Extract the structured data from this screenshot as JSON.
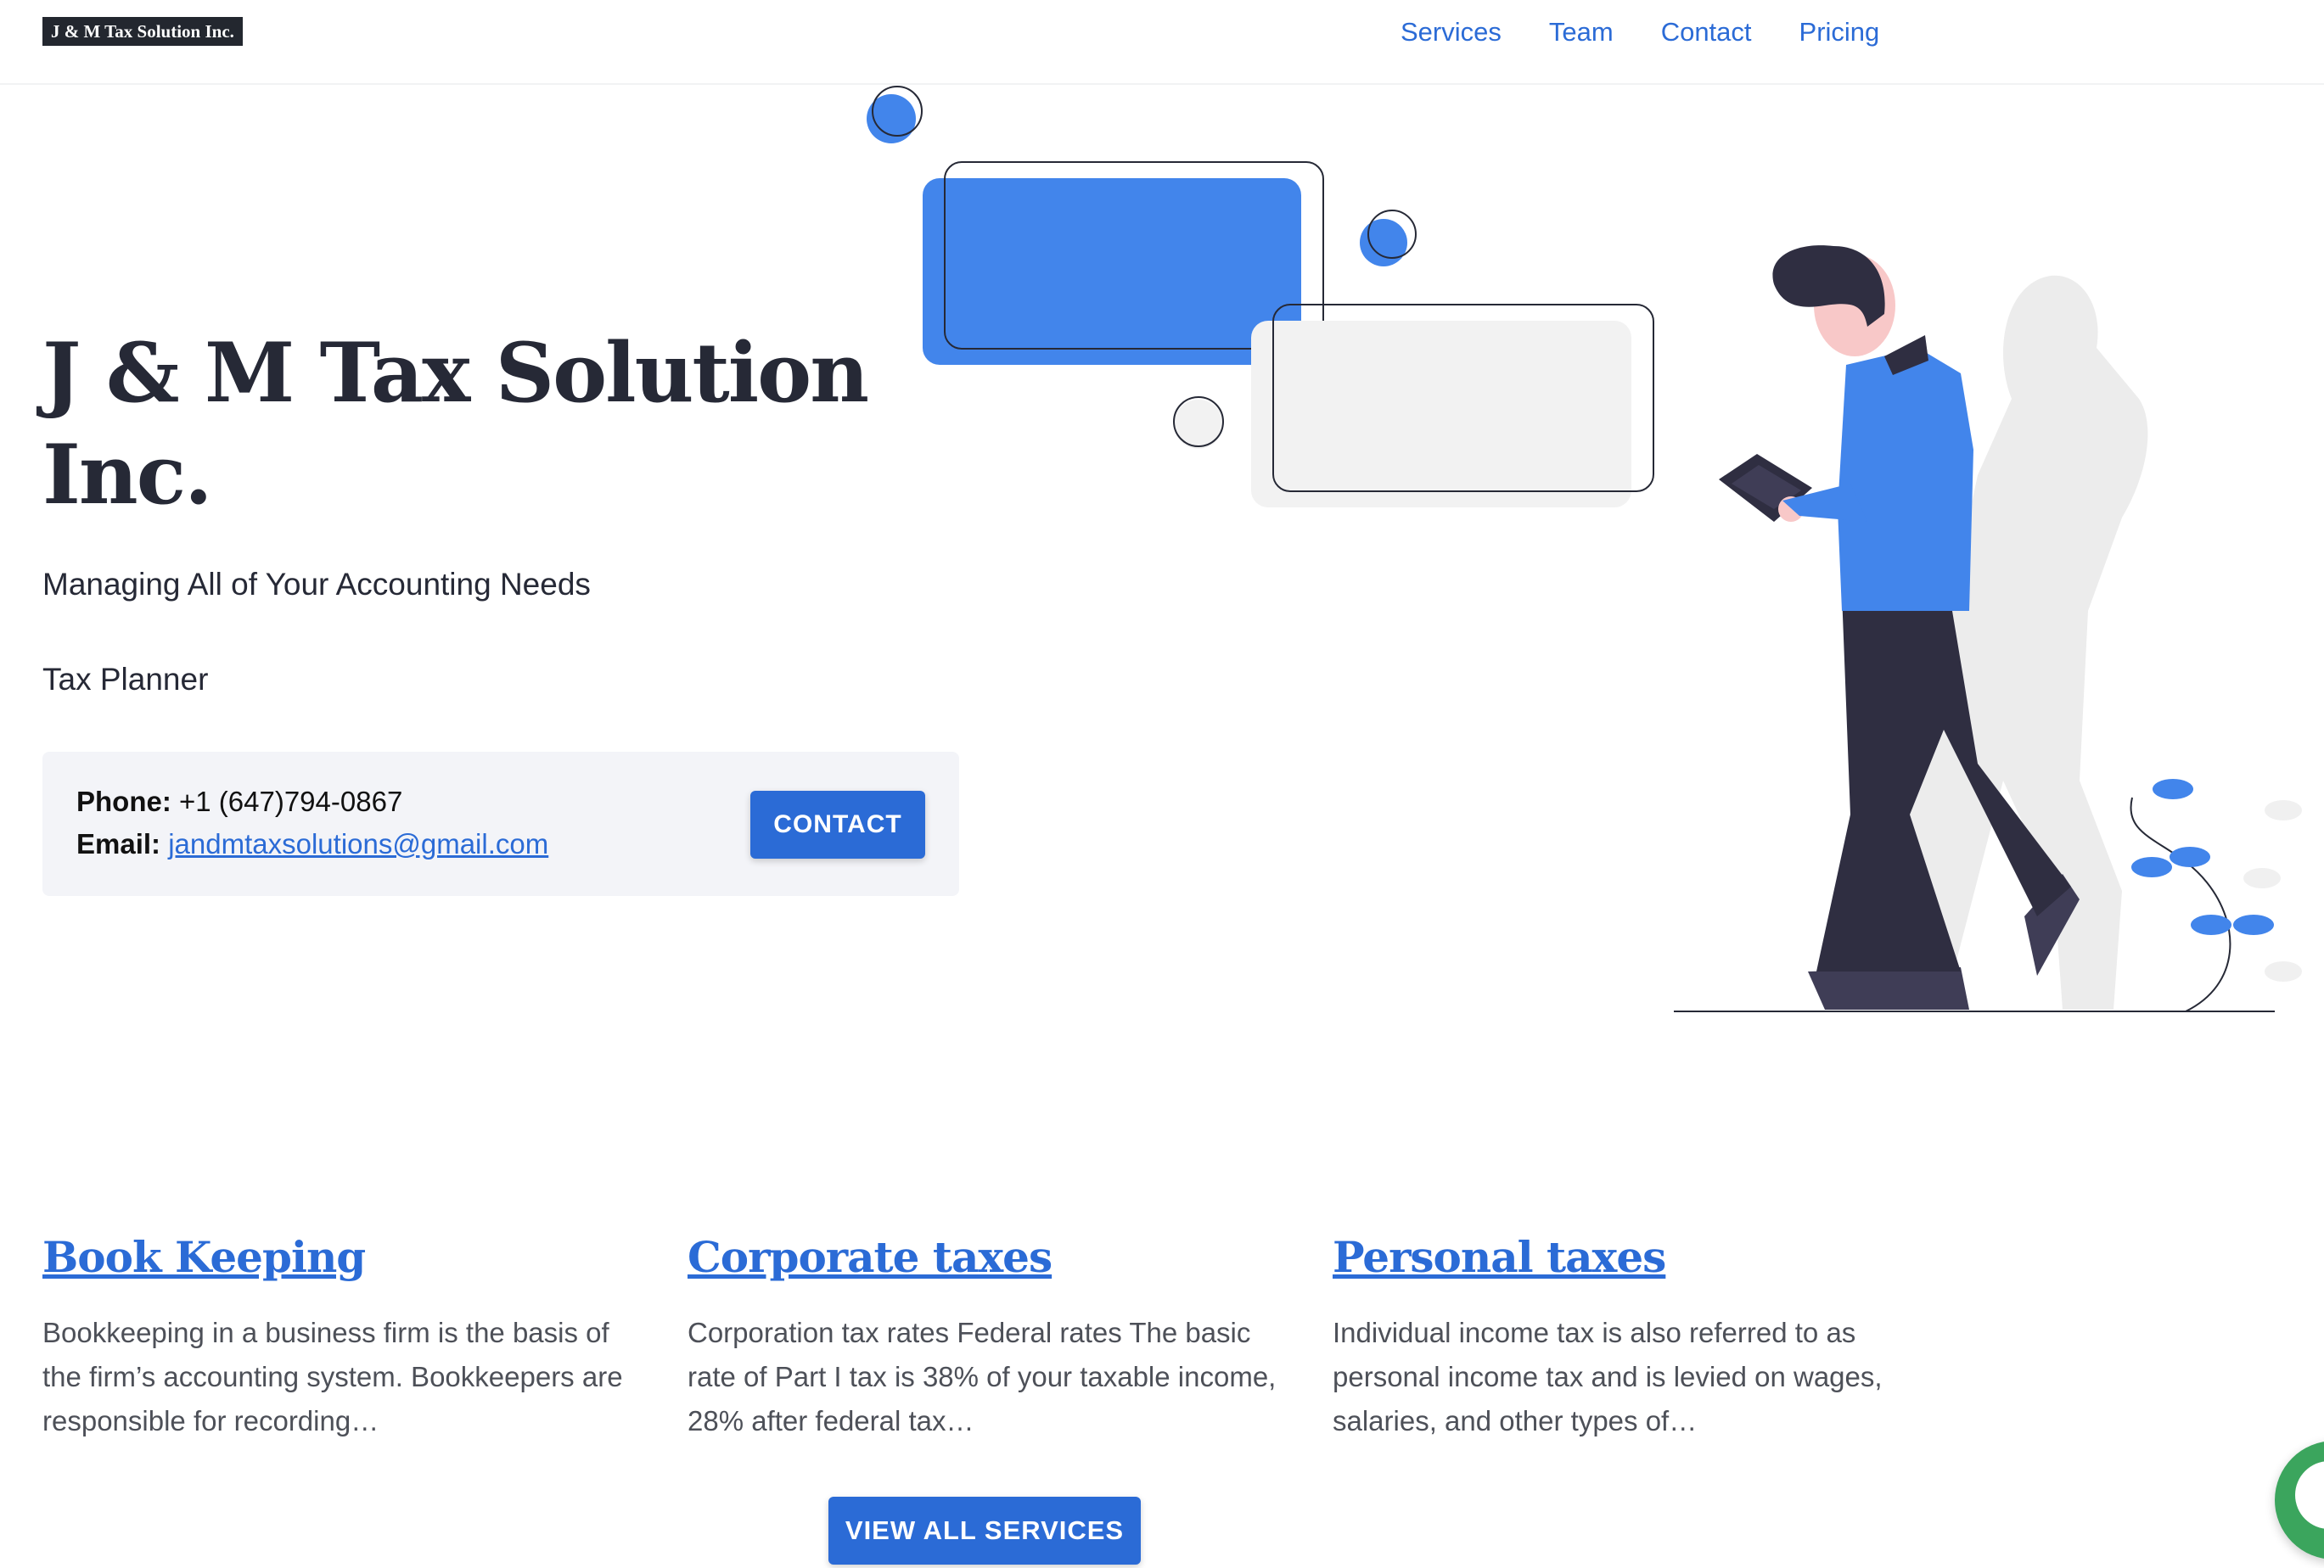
{
  "header": {
    "logo_text": "J & M Tax Solution Inc.",
    "nav": [
      "Services",
      "Team",
      "Contact",
      "Pricing"
    ]
  },
  "hero": {
    "title_line1": "J & M Tax Solution",
    "title_line2": "Inc.",
    "subtitle": "Managing All of Your Accounting Needs",
    "role": "Tax Planner",
    "phone_label": "Phone:",
    "phone": "+1 (647)794-0867",
    "email_label": "Email:",
    "email": "jandmtaxsolutions@gmail.com",
    "contact_button": "CONTACT"
  },
  "services": [
    {
      "title": "Book Keeping",
      "description": "Bookkeeping in a business firm is the basis of the firm’s accounting system. Bookkeepers are responsible for recording…"
    },
    {
      "title": "Corporate taxes",
      "description": "Corporation tax rates Federal rates The basic rate of Part I tax is 38% of your taxable income, 28% after federal tax…"
    },
    {
      "title": "Personal taxes",
      "description": "Individual income tax is also referred to as personal income tax and is levied on wages, salaries, and other types of…"
    }
  ],
  "view_all_button": "VIEW ALL SERVICES",
  "colors": {
    "accent": "#2b6bd6",
    "illustration_blue": "#4285eb",
    "dark": "#262936",
    "chat_green": "#3ba55d"
  },
  "icons": {
    "chat": "chat-icon"
  }
}
